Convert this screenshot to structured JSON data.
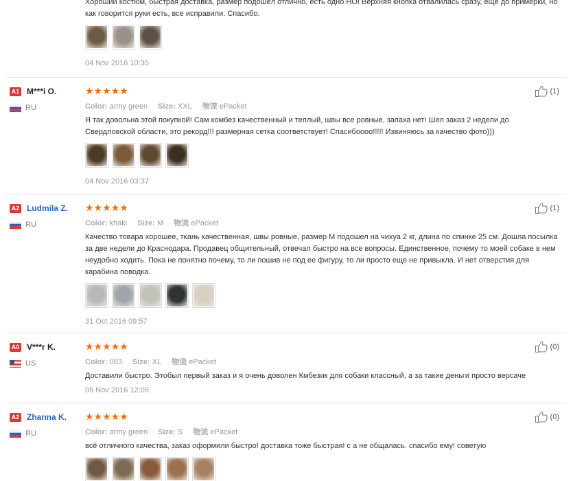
{
  "top_review": {
    "text": "Хороший костюм, быстрая доставка, размер подошёл отлично, есть одно НО! Верхняя кнопка отвалилась сразу, ещё до примерки, но как говорится руки есть, все исправили. Спасибо.",
    "date": "04 Nov 2016 10:35",
    "photo_colors": [
      "#6b5a45",
      "#9a9288",
      "#5d5048"
    ]
  },
  "reviews": [
    {
      "level": "A1",
      "level_color": "#d93636",
      "name": "M***i O.",
      "name_is_link": false,
      "country": "RU",
      "flag": "ru",
      "stars": "★★★★★",
      "attr_color_label": "Color:",
      "attr_color": "army green",
      "attr_size_label": "Size:",
      "attr_size": "XXL",
      "attr_ship_label": "物流",
      "attr_ship": "ePacket",
      "text": "Я так довольна этой покупкой! Сам комбез качественный и теплый, швы все ровные, запаха нет! Шел заказ 2 недели до Свердловской области, это рекорд!!! размерная сетка соответствует! Спасибоооо!!!!! Извиняюсь за качество фото)))",
      "photo_colors": [
        "#4a3a26",
        "#7a5a3a",
        "#5e4a30",
        "#3d2e22"
      ],
      "date": "04 Nov 2016 03:37",
      "helpful": "(1)"
    },
    {
      "level": "A2",
      "level_color": "#d93636",
      "name": "Ludmila Z.",
      "name_is_link": true,
      "country": "RU",
      "flag": "ru",
      "stars": "★★★★★",
      "attr_color_label": "Color:",
      "attr_color": "khaki",
      "attr_size_label": "Size:",
      "attr_size": "M",
      "attr_ship_label": "物流",
      "attr_ship": "ePacket",
      "text": "Качество товара хорошее, ткань качественная, швы ровные, размер М подошел на чихуа 2 кг, длина по спинке 25 см. Дошла посылка за две недели до Краснодара. Продавец общительный, отвечал быстро на все вопросы. Единственное, почему то моей собаке в нем неудобно ходить. Пока не понятно почему, то ли пошив не под ее фигуру, то ли просто еще не привыкла. И нет отверстия для карабина поводка.",
      "photo_colors": [
        "#b7b9b8",
        "#9ea7ab",
        "#c3c2ba",
        "#2f3336",
        "#d8d0c0"
      ],
      "date": "31 Oct 2016 09:57",
      "helpful": "(1)"
    },
    {
      "level": "A0",
      "level_color": "#d93636",
      "name": "V***r K.",
      "name_is_link": false,
      "country": "US",
      "flag": "us",
      "stars": "★★★★★",
      "attr_color_label": "Color:",
      "attr_color": "083",
      "attr_size_label": "Size:",
      "attr_size": "XL",
      "attr_ship_label": "物流",
      "attr_ship": "ePacket",
      "text": "Доставили быстро. Этобыл первый заказ и я очень доволен Кмбезик для собаки классный, а за такие деньги просто версаче",
      "photo_colors": [],
      "date": "05 Nov 2016 12:05",
      "helpful": "(0)"
    },
    {
      "level": "A2",
      "level_color": "#d93636",
      "name": "Zhanna K.",
      "name_is_link": true,
      "country": "RU",
      "flag": "ru",
      "stars": "★★★★★",
      "attr_color_label": "Color:",
      "attr_color": "army green",
      "attr_size_label": "Size:",
      "attr_size": "S",
      "attr_ship_label": "物流",
      "attr_ship": "ePacket",
      "text": "всё отличного качества, заказ оформили быстро! доставка тоже быстрая! с а не общалась. спасибо ему! советую",
      "photo_colors": [
        "#6e5a44",
        "#7d6a52",
        "#8a5a3e",
        "#9c7050",
        "#a88062"
      ],
      "date": "",
      "helpful": "(0)"
    }
  ]
}
